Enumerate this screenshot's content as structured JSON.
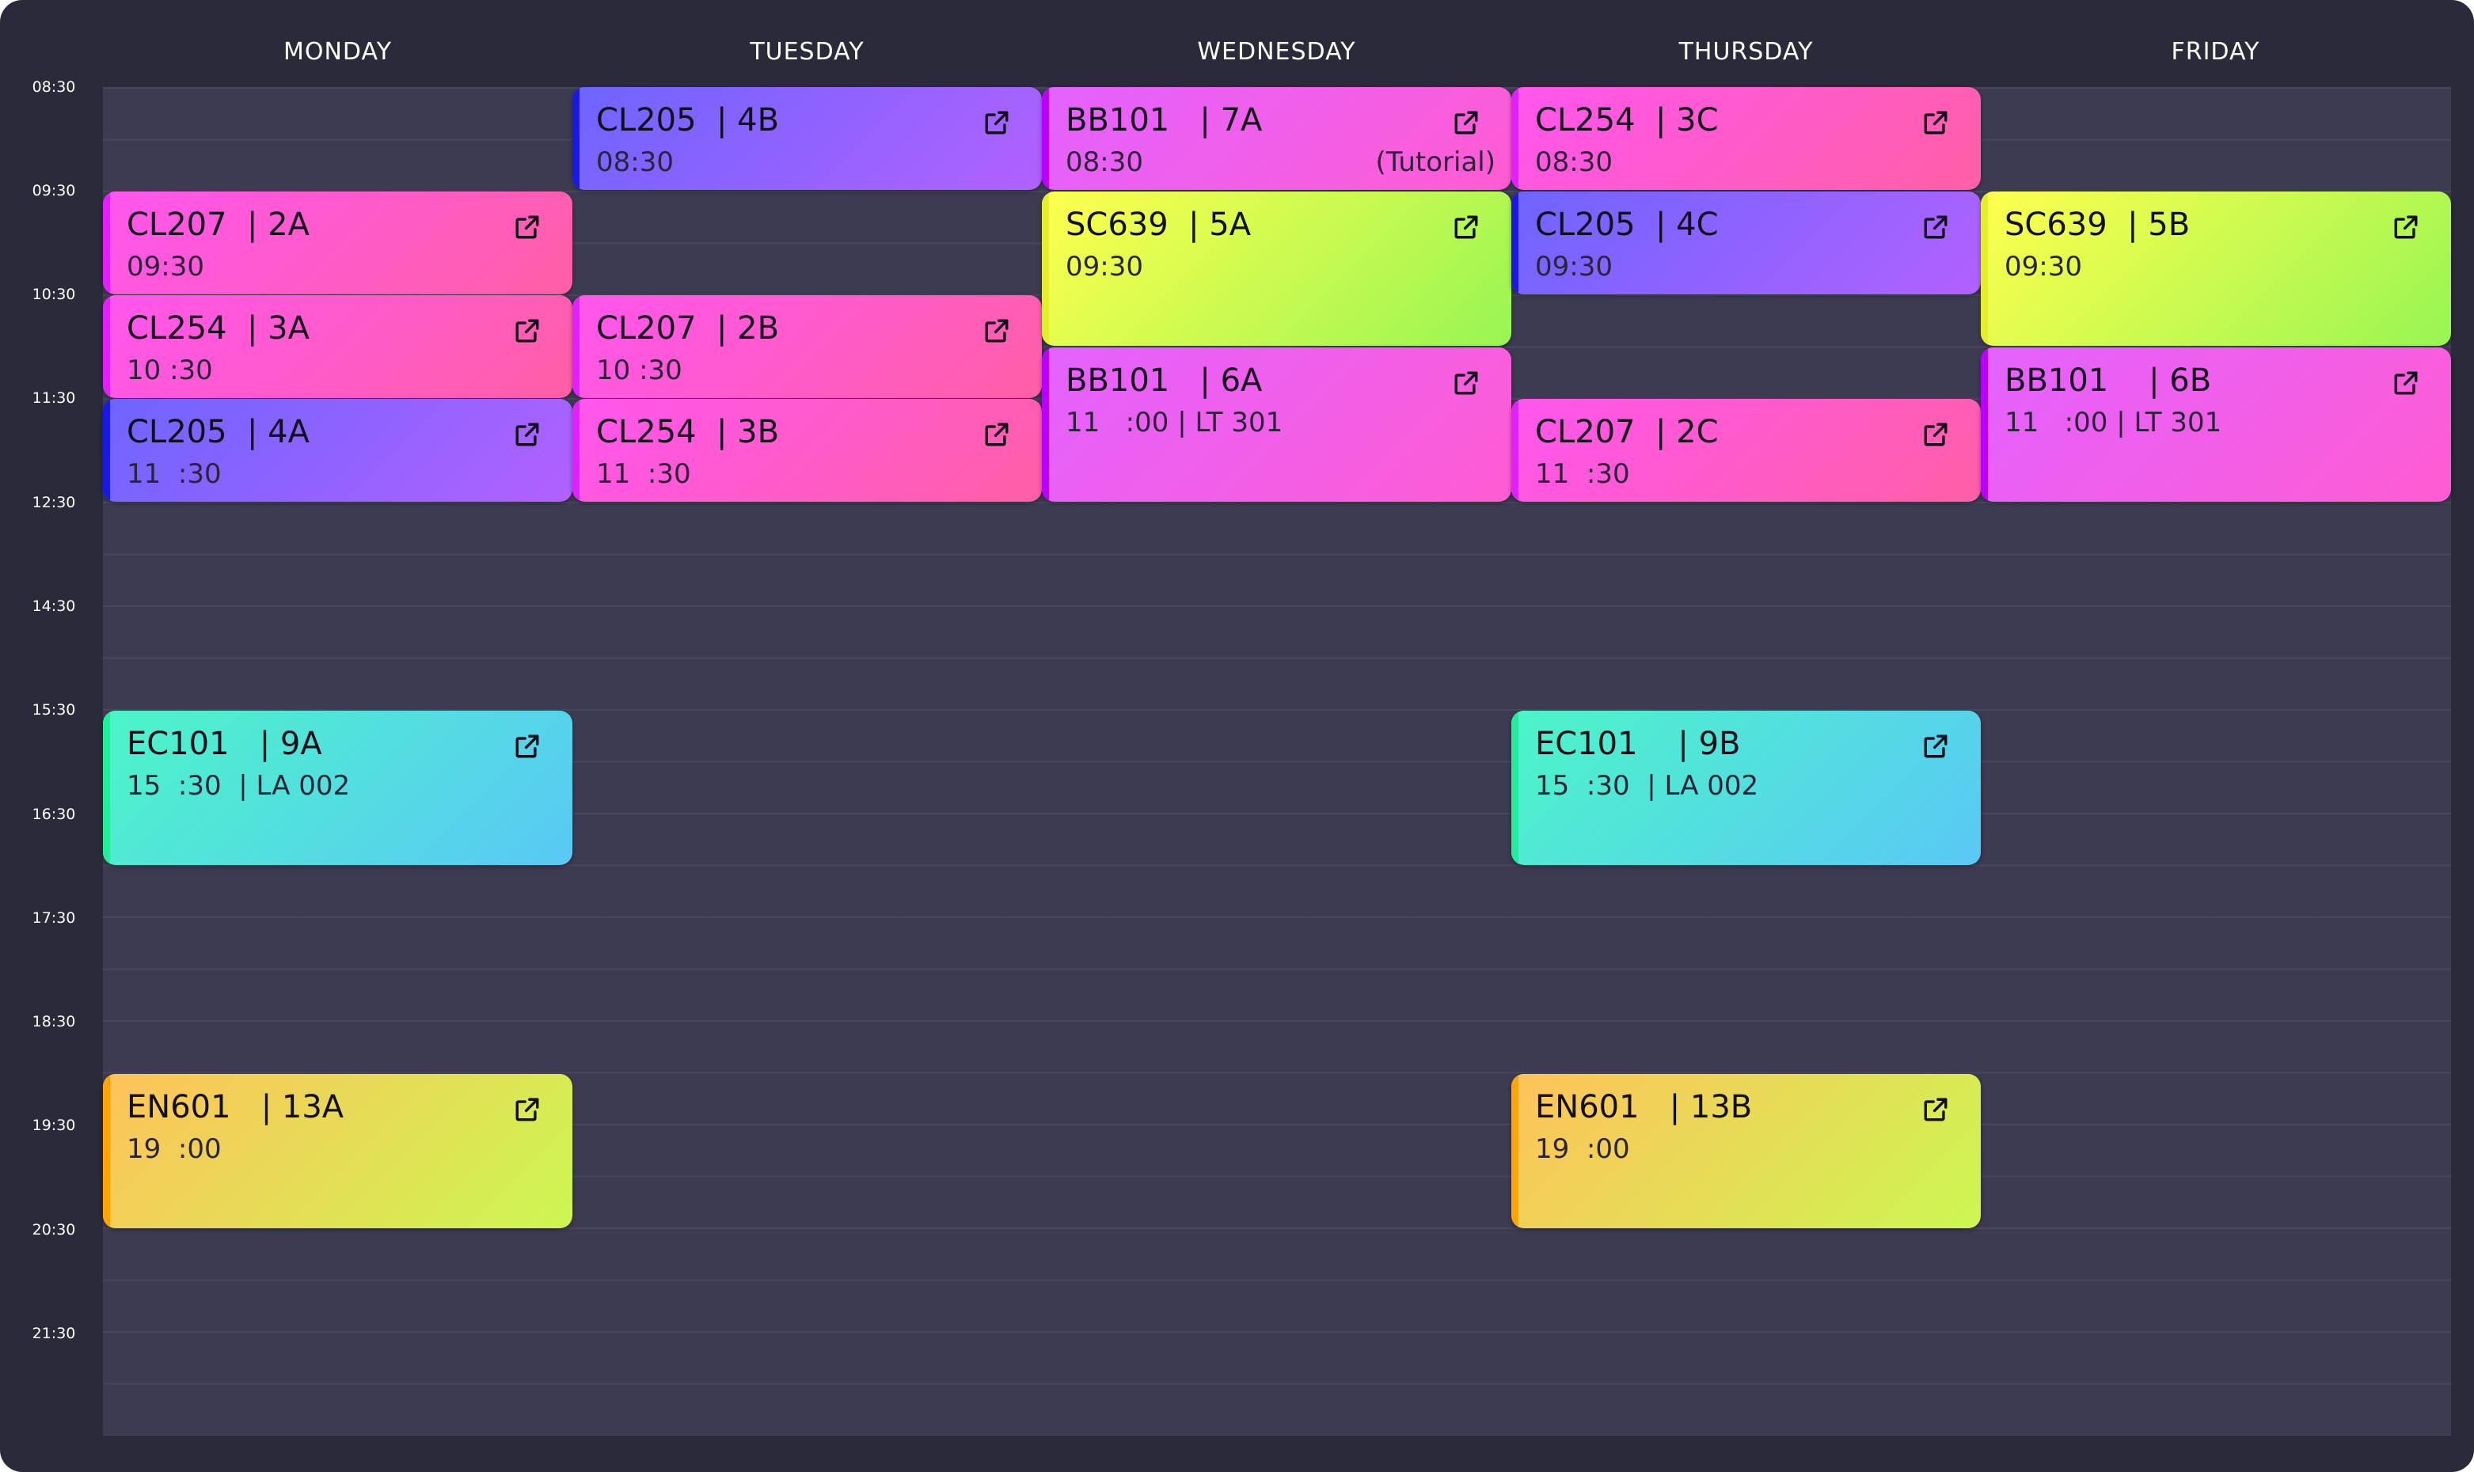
{
  "days": [
    "MONDAY",
    "TUESDAY",
    "WEDNESDAY",
    "THURSDAY",
    "FRIDAY"
  ],
  "times": [
    "08:30",
    "09:30",
    "10:30",
    "11:30",
    "12:30",
    "14:30",
    "15:30",
    "16:30",
    "17:30",
    "18:30",
    "19:30",
    "20:30",
    "21:30"
  ],
  "icons": {
    "open": "external-link-icon"
  },
  "colors": {
    "background": "#2b2a3a",
    "grid": "#3d3b52",
    "text_light": "#ffffff",
    "text_dark": "#111018"
  },
  "events": {
    "mon": [
      {
        "title": "CL207  | 2A",
        "time": "09:30"
      },
      {
        "title": "CL254  | 3A",
        "time": "10 :30"
      },
      {
        "title": "CL205  | 4A",
        "time": "11  :30"
      },
      {
        "title": "EC101   | 9A",
        "time": "15  :30  | LA 002"
      },
      {
        "title": "EN601   | 13A",
        "time": "19  :00"
      }
    ],
    "tue": [
      {
        "title": "CL205  | 4B",
        "time": "08:30"
      },
      {
        "title": "CL207  | 2B",
        "time": "10 :30"
      },
      {
        "title": "CL254  | 3B",
        "time": "11  :30"
      }
    ],
    "wed": [
      {
        "title": "BB101   | 7A",
        "time": "08:30",
        "note": "(Tutorial)"
      },
      {
        "title": "SC639  | 5A",
        "time": "09:30"
      },
      {
        "title": "BB101   | 6A",
        "time": "11   :00 | LT 301"
      }
    ],
    "thu": [
      {
        "title": "CL254  | 3C",
        "time": "08:30"
      },
      {
        "title": "CL205  | 4C",
        "time": "09:30"
      },
      {
        "title": "CL207  | 2C",
        "time": "11  :30"
      },
      {
        "title": "EC101    | 9B",
        "time": "15  :30  | LA 002"
      },
      {
        "title": "EN601   | 13B",
        "time": "19  :00"
      }
    ],
    "fri": [
      {
        "title": "SC639  | 5B",
        "time": "09:30"
      },
      {
        "title": "BB101    | 6B",
        "time": "11   :00 | LT 301"
      }
    ]
  }
}
